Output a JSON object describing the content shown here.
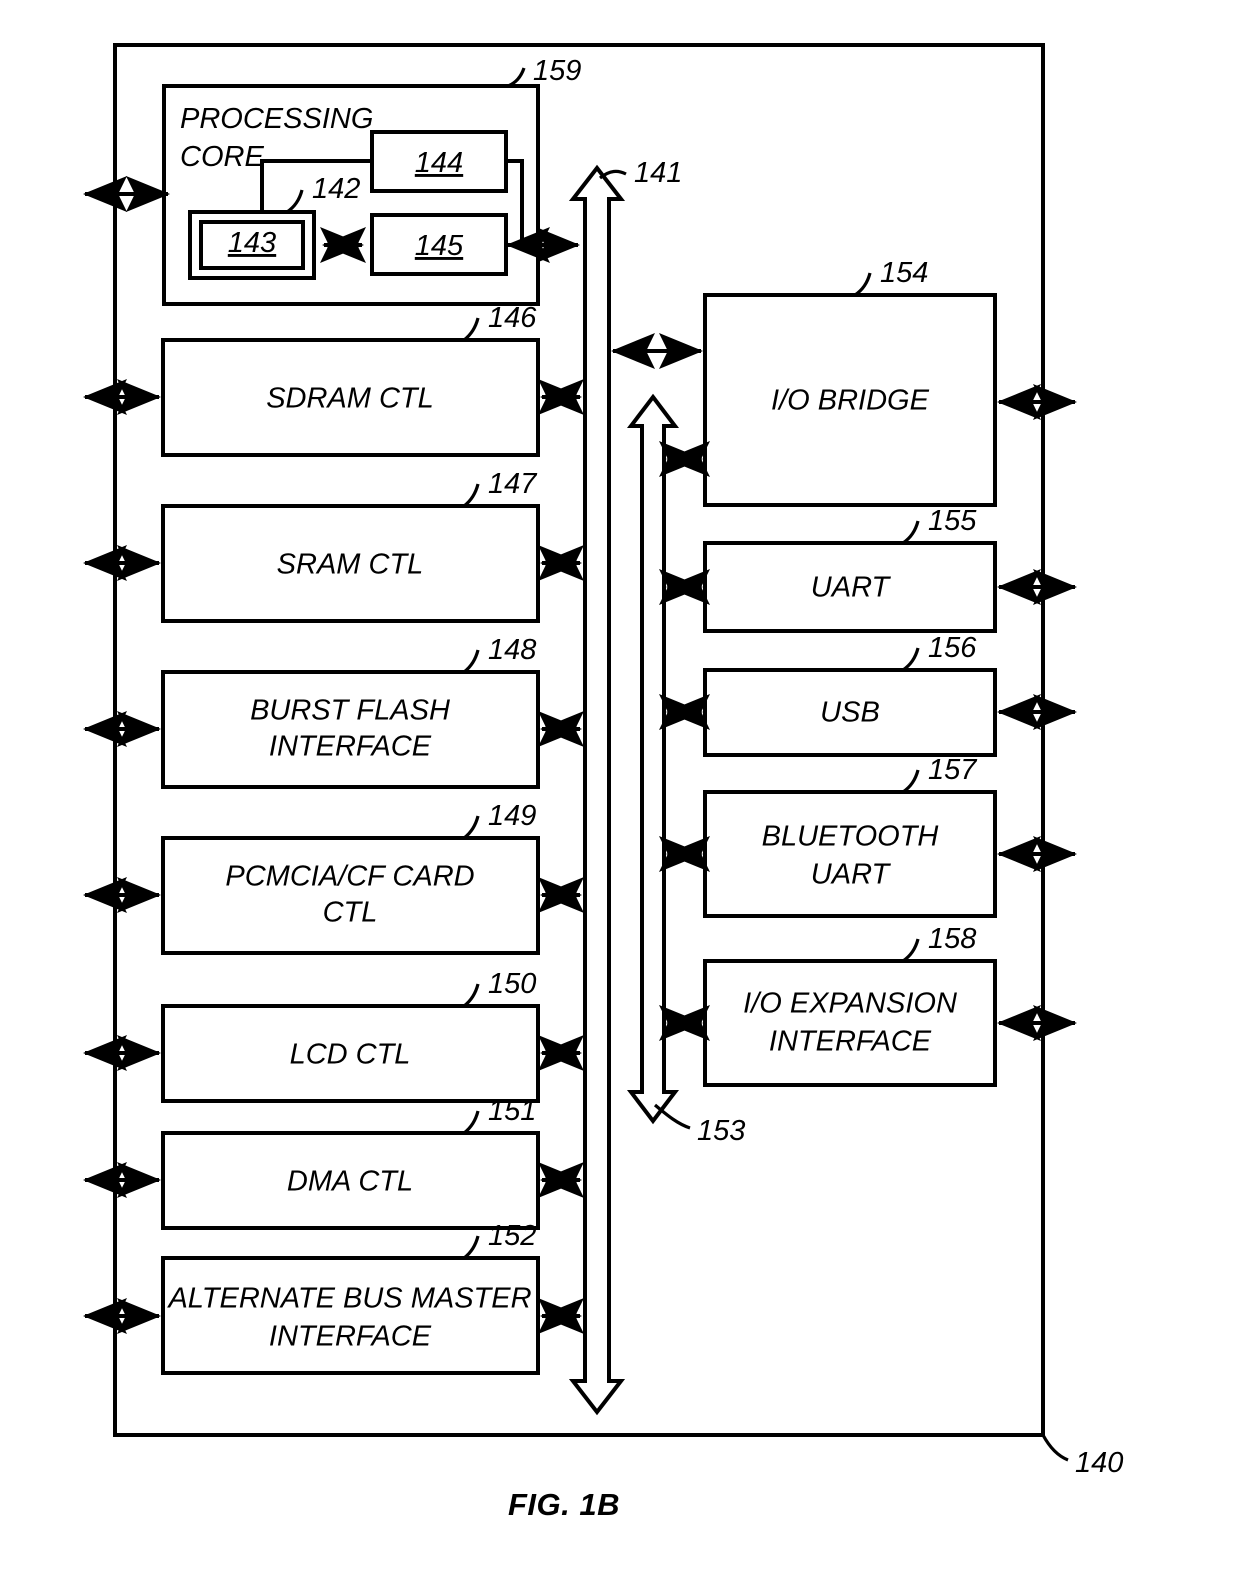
{
  "figure": {
    "caption": "FIG. 1B",
    "system_ref": "140",
    "bus_main_ref": "141",
    "bus_secondary_ref": "153"
  },
  "core": {
    "title_line1": "PROCESSING",
    "title_line2": "CORE",
    "ref": "159",
    "units": [
      {
        "id": "cache-unit",
        "label": "142",
        "ref": "142"
      },
      {
        "id": "inner-cache",
        "label": "143"
      },
      {
        "id": "decode-unit",
        "label": "144"
      },
      {
        "id": "execution-unit",
        "label": "145"
      }
    ]
  },
  "left_column": {
    "blocks": [
      {
        "name": "sdram-ctl",
        "label": "SDRAM CTL",
        "lines": [
          "SDRAM CTL"
        ],
        "ref": "146"
      },
      {
        "name": "sram-ctl",
        "label": "SRAM CTL",
        "lines": [
          "SRAM CTL"
        ],
        "ref": "147"
      },
      {
        "name": "burst-flash",
        "label": "BURST FLASH INTERFACE",
        "lines": [
          "BURST FLASH",
          "INTERFACE"
        ],
        "ref": "148"
      },
      {
        "name": "pcmcia-cf",
        "label": "PCMCIA/CF CARD CTL",
        "lines": [
          "PCMCIA/CF CARD",
          "CTL"
        ],
        "ref": "149"
      },
      {
        "name": "lcd-ctl",
        "label": "LCD CTL",
        "lines": [
          "LCD CTL"
        ],
        "ref": "150"
      },
      {
        "name": "dma-ctl",
        "label": "DMA CTL",
        "lines": [
          "DMA CTL"
        ],
        "ref": "151"
      },
      {
        "name": "alt-bus-master",
        "label": "ALTERNATE BUS MASTER INTERFACE",
        "lines": [
          "ALTERNATE BUS MASTER",
          "INTERFACE"
        ],
        "ref": "152"
      }
    ]
  },
  "right_column": {
    "blocks": [
      {
        "name": "io-bridge",
        "label": "I/O BRIDGE",
        "lines": [
          "I/O BRIDGE"
        ],
        "ref": "154"
      },
      {
        "name": "uart",
        "label": "UART",
        "lines": [
          "UART"
        ],
        "ref": "155"
      },
      {
        "name": "usb",
        "label": "USB",
        "lines": [
          "USB"
        ],
        "ref": "156"
      },
      {
        "name": "bluetooth-uart",
        "label": "BLUETOOTH UART",
        "lines": [
          "BLUETOOTH",
          "UART"
        ],
        "ref": "157"
      },
      {
        "name": "io-expansion",
        "label": "I/O EXPANSION INTERFACE",
        "lines": [
          "I/O EXPANSION",
          "INTERFACE"
        ],
        "ref": "158"
      }
    ]
  },
  "colors": {
    "stroke": "#000000",
    "fill": "#ffffff"
  }
}
